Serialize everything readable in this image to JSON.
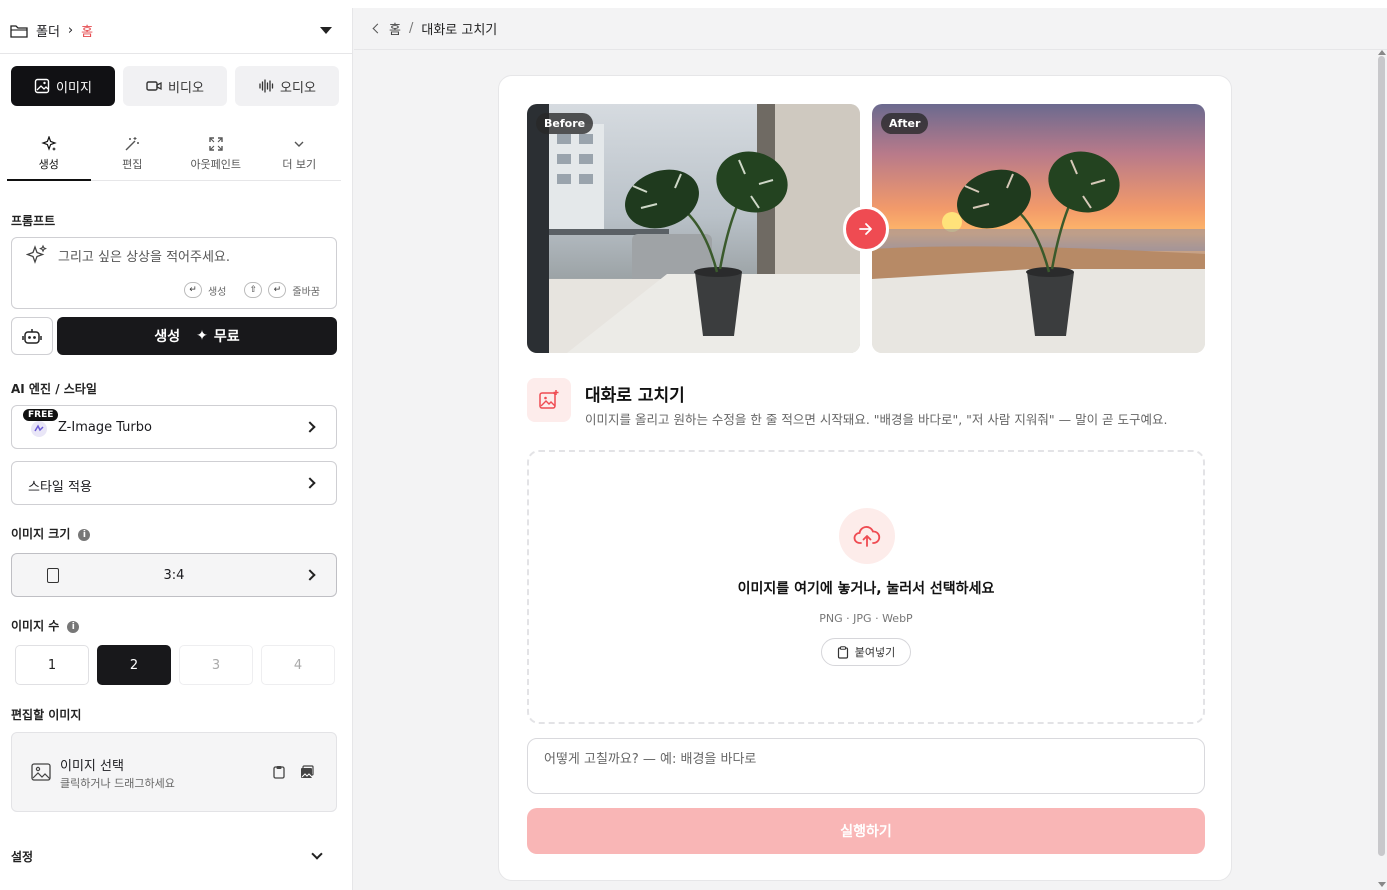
{
  "sidebar": {
    "folder": {
      "label": "폴더",
      "current": "홈"
    },
    "media_tabs": [
      {
        "label": "이미지",
        "icon": "image-icon",
        "active": true
      },
      {
        "label": "비디오",
        "icon": "video-icon",
        "active": false
      },
      {
        "label": "오디오",
        "icon": "audio-icon",
        "active": false
      }
    ],
    "mode_tabs": [
      {
        "label": "생성",
        "icon": "sparkles-icon",
        "active": true
      },
      {
        "label": "편집",
        "icon": "magic-wand-icon",
        "active": false
      },
      {
        "label": "아웃페인트",
        "icon": "expand-icon",
        "active": false
      },
      {
        "label": "더 보기",
        "icon": "chevron-down-icon",
        "active": false
      }
    ],
    "prompt": {
      "label": "프롬프트",
      "placeholder": "그리고 싶은 상상을 적어주세요.",
      "hint_generate": "생성",
      "hint_newline": "줄바꿈"
    },
    "generate_button": {
      "label": "생성",
      "price": "무료"
    },
    "engine": {
      "label": "AI 엔진 / 스타일",
      "badge": "FREE",
      "name": "Z-Image Turbo",
      "style_label": "스타일 적용"
    },
    "image_size": {
      "label": "이미지 크기",
      "value": "3:4"
    },
    "image_count": {
      "label": "이미지 수",
      "options": [
        "1",
        "2",
        "3",
        "4"
      ],
      "selected": "2"
    },
    "edit_image": {
      "label": "편집할 이미지",
      "title": "이미지 선택",
      "subtitle": "클릭하거나 드래그하세요"
    },
    "settings": {
      "label": "설정"
    }
  },
  "breadcrumb": {
    "home": "홈",
    "separator": "/",
    "current": "대화로 고치기"
  },
  "preview": {
    "before_tag": "Before",
    "after_tag": "After"
  },
  "feature": {
    "title": "대화로 고치기",
    "description": "이미지를 올리고 원하는 수정을 한 줄 적으면 시작돼요. \"배경을 바다로\", \"저 사람 지워줘\" — 말이 곧 도구예요."
  },
  "dropzone": {
    "title": "이미지를 여기에 놓거나, 눌러서 선택하세요",
    "formats": "PNG · JPG · WebP",
    "paste_label": "붙여넣기"
  },
  "instruction": {
    "placeholder": "어떻게 고칠까요? — 예: 배경을 바다로"
  },
  "run_button": {
    "label": "실행하기"
  },
  "colors": {
    "accent": "#ef4b52",
    "run_disabled": "#f9b6b6",
    "dark": "#18181b"
  }
}
